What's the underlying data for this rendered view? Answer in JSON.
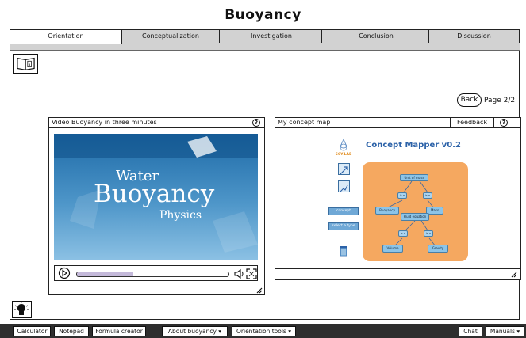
{
  "title": "Buoyancy",
  "tabs": [
    {
      "label": "Orientation"
    },
    {
      "label": "Conceptualization"
    },
    {
      "label": "Investigation"
    },
    {
      "label": "Conclusion"
    },
    {
      "label": "Discussion"
    }
  ],
  "navigation": {
    "back_label": "Back",
    "page_indicator": "Page 2/2"
  },
  "video_panel": {
    "title": "Video Buoyancy in three minutes",
    "help_label": "?",
    "video_text": {
      "line1": "Water",
      "line2": "Buoyancy",
      "line3": "Physics"
    },
    "progress": 0.37
  },
  "concept_panel": {
    "title": "My concept map",
    "feedback_label": "Feedback",
    "help_label": "?",
    "mapper_title": "Concept Mapper v0.2",
    "logo_text": "SCY-LAB",
    "tool_concept": "concept",
    "tool_select": "select a type",
    "nodes": [
      "Unit of mass",
      "Buoyancy",
      "Mass",
      "Fluid equation",
      "Volume",
      "Gravity"
    ],
    "links": [
      "is a",
      "is a",
      "is a",
      "is a"
    ]
  },
  "bottom_bar": {
    "calculator": "Calculator",
    "notepad": "Notepad",
    "formula_creator": "Formula creator",
    "about_buoyancy": "About buoyancy ▾",
    "orientation_tools": "Orientation tools ▾",
    "chat": "Chat",
    "manuals": "Manuals ▾"
  },
  "colors": {
    "tab_gray": "#d2d2d2",
    "video_blue": "#2f7fbd",
    "concept_orange": "#f5a860",
    "node_blue": "#8cc4e8"
  }
}
